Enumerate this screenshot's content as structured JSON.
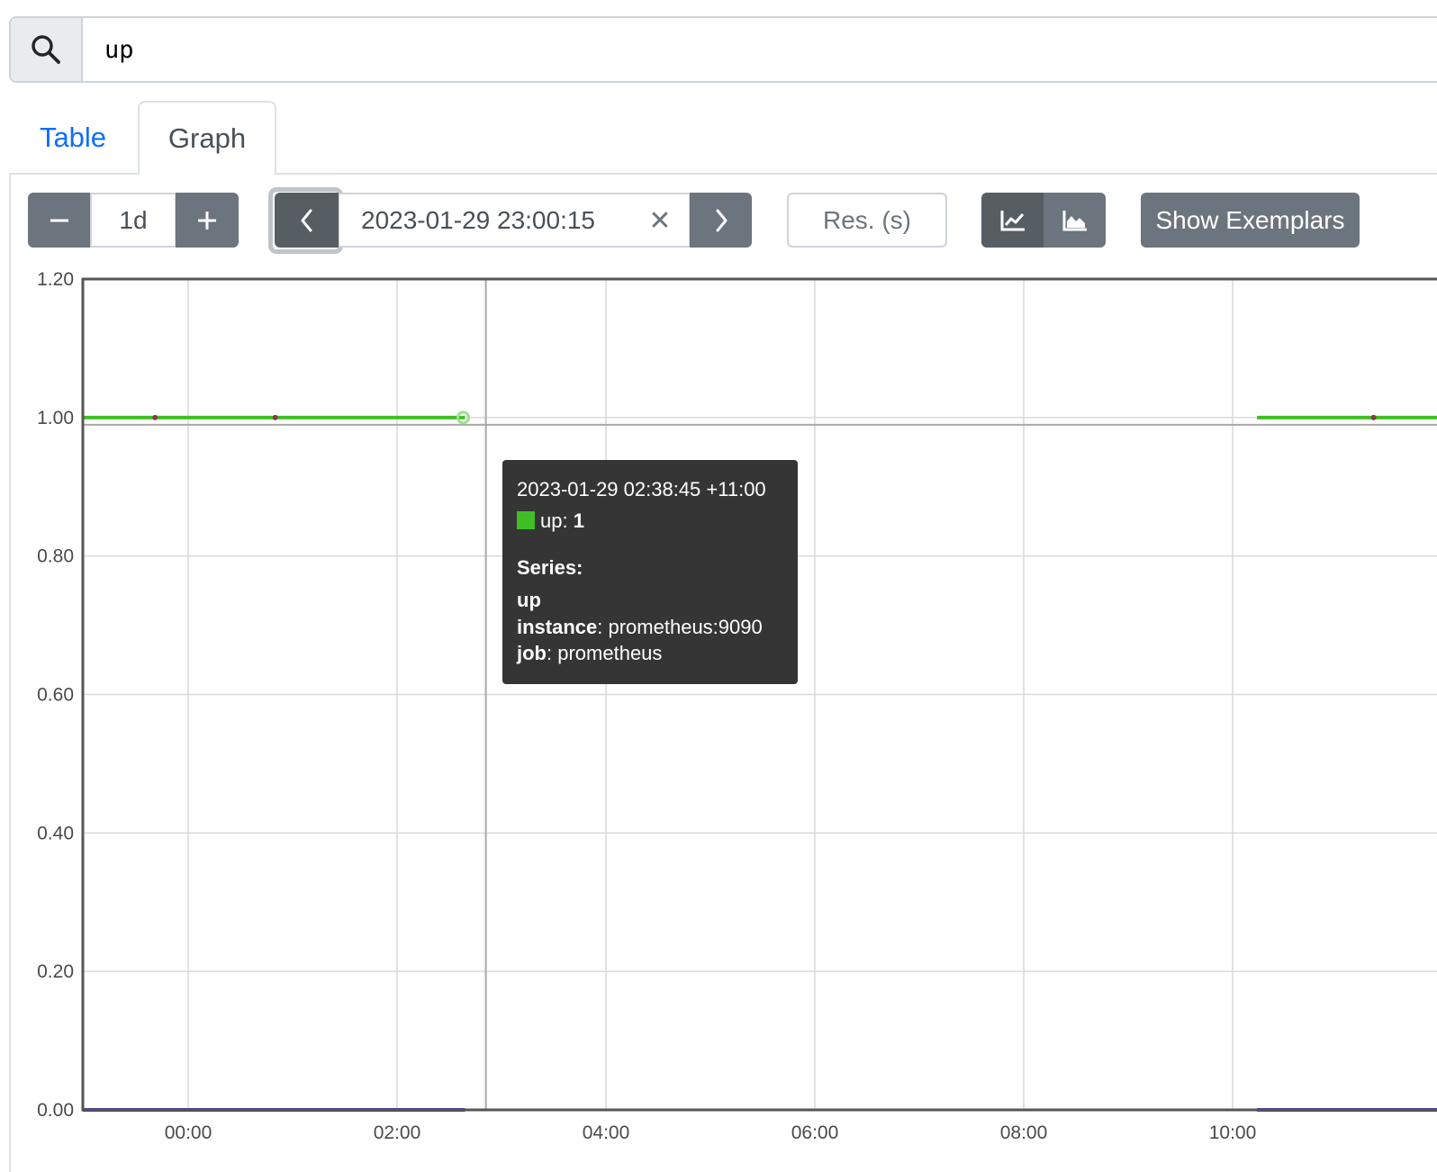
{
  "query": {
    "value": "up",
    "icon": "search-icon"
  },
  "tabs": [
    {
      "label": "Table",
      "active": false
    },
    {
      "label": "Graph",
      "active": true
    }
  ],
  "controls": {
    "range": {
      "minus_icon": "minus-icon",
      "value": "1d",
      "plus_icon": "plus-icon"
    },
    "end_time": {
      "prev_icon": "chevron-left-icon",
      "value": "2023-01-29 23:00:15",
      "clear": "✕",
      "next_icon": "chevron-right-icon"
    },
    "resolution": {
      "placeholder": "Res. (s)"
    },
    "chart_mode": {
      "line_icon": "line-chart-icon",
      "stacked_icon": "area-chart-icon",
      "active": "line"
    },
    "exemplars_label": "Show Exemplars"
  },
  "tooltip": {
    "time": "2023-01-29 02:38:45 +11:00",
    "series_name": "up",
    "value": "1",
    "series_heading": "Series:",
    "metric": "up",
    "labels": [
      {
        "key": "instance",
        "value": "prometheus:9090"
      },
      {
        "key": "job",
        "value": "prometheus"
      }
    ],
    "swatch_color": "#3fbf24"
  },
  "chart_data": {
    "type": "line",
    "x_ticks": [
      "00:00",
      "02:00",
      "04:00",
      "06:00",
      "08:00",
      "10:00"
    ],
    "y_ticks": [
      "0.00",
      "0.20",
      "0.40",
      "0.60",
      "0.80",
      "1.00",
      "1.20"
    ],
    "ylim": [
      0,
      1.2
    ],
    "xlim": [
      "-01:00",
      "12:00"
    ],
    "grid": true,
    "series": [
      {
        "color": "#3fbf24",
        "segments": [
          {
            "x": [
              "-01:00",
              "02:39"
            ],
            "y": 1
          },
          {
            "x": [
              "10:14",
              "12:00"
            ],
            "y": 1
          }
        ]
      },
      {
        "color": "#3335c8",
        "segments": [
          {
            "x": [
              "-01:00",
              "02:39"
            ],
            "y": 0
          },
          {
            "x": [
              "10:14",
              "12:00"
            ],
            "y": 0
          }
        ]
      }
    ],
    "hover_time": "02:51",
    "hover_point": {
      "x": "02:38",
      "y": 1
    },
    "exemplar_points": [
      {
        "x": "23:41",
        "y": 1
      },
      {
        "x": "00:50",
        "y": 1
      },
      {
        "x": "11:21",
        "y": 1
      }
    ]
  }
}
